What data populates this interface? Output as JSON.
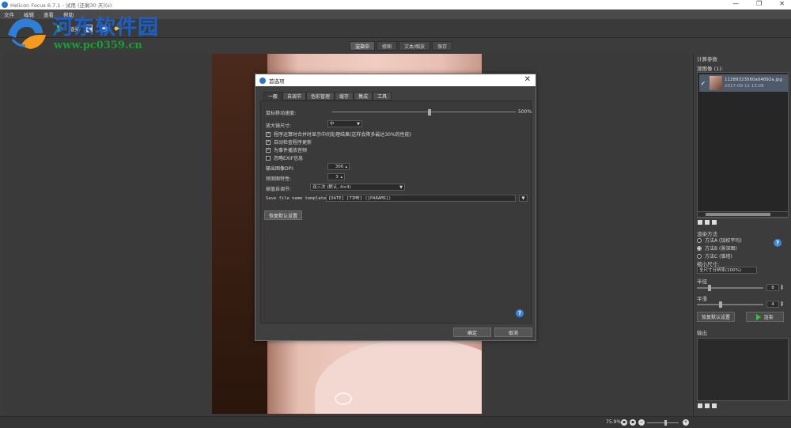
{
  "window": {
    "title": "Helicon Focus 6.7.1 - 试用 (还剩30 天)(s)",
    "minimize": "—",
    "maximize": "❐",
    "close": "✕"
  },
  "menu": [
    "文件",
    "编辑",
    "查看",
    "帮助"
  ],
  "toolbar": {
    "render_label": "渲染"
  },
  "watermark": {
    "site_name": "河东软件园",
    "url": "www.pc0359.cn"
  },
  "view_tabs": [
    {
      "label": "渲染中",
      "active": true
    },
    {
      "label": "修图",
      "active": false
    },
    {
      "label": "文本/缩放",
      "active": false
    },
    {
      "label": "保存",
      "active": false
    }
  ],
  "right_panel": {
    "heading": "计算参数",
    "source_heading": "源图像 (1):",
    "source_file": {
      "name": "11289323560a04892a.jpg",
      "date": "2017-09-12 13:08"
    },
    "method_heading": "渲染方法",
    "methods": [
      {
        "label": "方法A (加权平均)",
        "selected": false
      },
      {
        "label": "方法B (景深图)",
        "selected": true
      },
      {
        "label": "方法C (锥塔)",
        "selected": false
      }
    ],
    "min_size_heading": "缩小尺寸:",
    "min_size_value": "全尺寸分辨率(100%)",
    "radius_heading": "半径",
    "radius_value": "8",
    "smoothing_heading": "平滑",
    "smoothing_value": "4",
    "reset_button": "恢复默认设置",
    "render_button": "渲染",
    "output_heading": "输出"
  },
  "status": {
    "zoom": "75.9%"
  },
  "dialog": {
    "title": "首选项",
    "close": "✕",
    "tabs": [
      {
        "label": "一般",
        "active": true
      },
      {
        "label": "自调节",
        "active": false
      },
      {
        "label": "色彩管理",
        "active": false
      },
      {
        "label": "缓存",
        "active": false
      },
      {
        "label": "集成",
        "active": false
      },
      {
        "label": "工具",
        "active": false
      }
    ],
    "mouse_speed_label": "鼠标移动速度:",
    "mouse_speed_max": "500%",
    "mouse_speed_level": 0.52,
    "magnifier_label": "放大镜尺寸:",
    "magnifier_value": "中",
    "checkboxes": [
      {
        "label": "程序运算时合并时显示中间处理结果(这样会降多最达30%的性能)",
        "checked": true
      },
      {
        "label": "自动检查程序更新",
        "checked": true
      },
      {
        "label": "为事件播放音频",
        "checked": true
      },
      {
        "label": "忽略EXIF信息",
        "checked": false
      }
    ],
    "dpi_label": "输出图像DPI:",
    "dpi_value": "300",
    "thumbs_label": "预测图特性:",
    "thumbs_value": "3",
    "interp_label": "插值自调节:",
    "interp_value": "双三次 (默认, 4×4)",
    "template_label": "Save file name template:",
    "template_value": "[DATE] [TIME] ([PARAMS])",
    "reset_button": "恢复默认设置",
    "ok_button": "确定",
    "cancel_button": "取消",
    "help": "?"
  }
}
